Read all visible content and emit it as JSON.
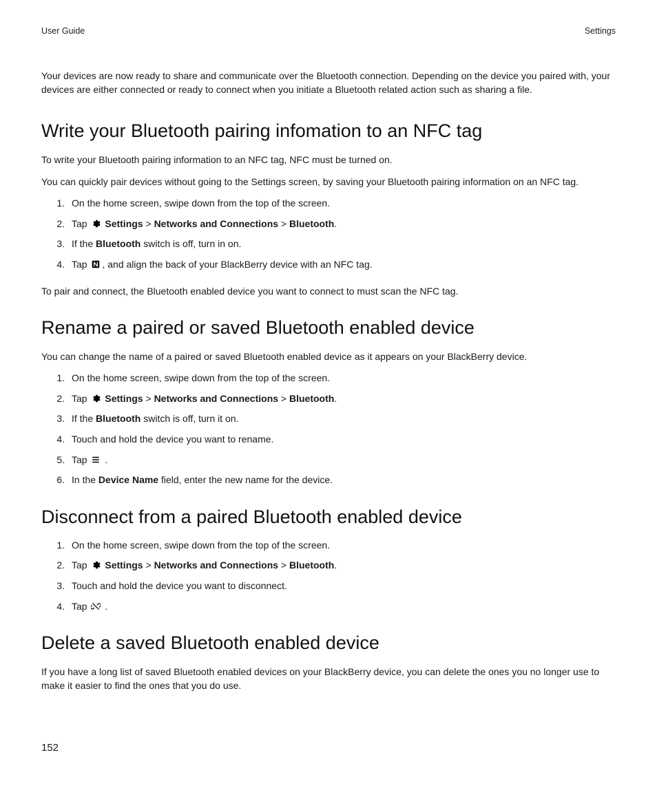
{
  "header": {
    "left": "User Guide",
    "right": "Settings"
  },
  "intro": "Your devices are now ready to share and communicate over the Bluetooth connection. Depending on the device you paired with, your devices are either connected or ready to connect when you initiate a Bluetooth related action such as sharing a file.",
  "section1": {
    "title": "Write your Bluetooth pairing infomation to an NFC tag",
    "p1": "To write your Bluetooth pairing information to an NFC tag, NFC must be turned on.",
    "p2": "You can quickly pair devices without going to the Settings screen, by saving your Bluetooth pairing information on an NFC tag.",
    "step1": "On the home screen, swipe down from the top of the screen.",
    "step2_pre": "Tap ",
    "step2_settings": "Settings",
    "step2_nc": "Networks and Connections",
    "step2_bt": "Bluetooth",
    "step3_pre": "If the ",
    "step3_bt": "Bluetooth",
    "step3_post": " switch is off, turn in on.",
    "step4_pre": "Tap ",
    "step4_post": ", and align the back of your BlackBerry device with an NFC tag.",
    "p3": "To pair and connect, the Bluetooth enabled device you want to connect to must scan the NFC tag."
  },
  "section2": {
    "title": "Rename a paired or saved Bluetooth enabled device",
    "p1": "You can change the name of a paired or saved Bluetooth enabled device as it appears on your BlackBerry device.",
    "step1": "On the home screen, swipe down from the top of the screen.",
    "step2_pre": "Tap ",
    "step2_settings": "Settings",
    "step2_nc": "Networks and Connections",
    "step2_bt": "Bluetooth",
    "step3_pre": "If the ",
    "step3_bt": "Bluetooth",
    "step3_post": " switch is off, turn it on.",
    "step4": "Touch and hold the device you want to rename.",
    "step5_pre": "Tap ",
    "step5_post": " .",
    "step6_pre": "In the ",
    "step6_field": "Device Name",
    "step6_post": " field, enter the new name for the device."
  },
  "section3": {
    "title": "Disconnect from a paired Bluetooth enabled device",
    "step1": "On the home screen, swipe down from the top of the screen.",
    "step2_pre": "Tap ",
    "step2_settings": "Settings",
    "step2_nc": "Networks and Connections",
    "step2_bt": "Bluetooth",
    "step3": "Touch and hold the device you want to disconnect.",
    "step4_pre": "Tap ",
    "step4_post": " ."
  },
  "section4": {
    "title": "Delete a saved Bluetooth enabled device",
    "p1": "If you have a long list of saved Bluetooth enabled devices on your BlackBerry device, you can delete the ones you no longer use to make it easier to find the ones that you do use."
  },
  "page_number": "152",
  "sep": " > ",
  "period": "."
}
